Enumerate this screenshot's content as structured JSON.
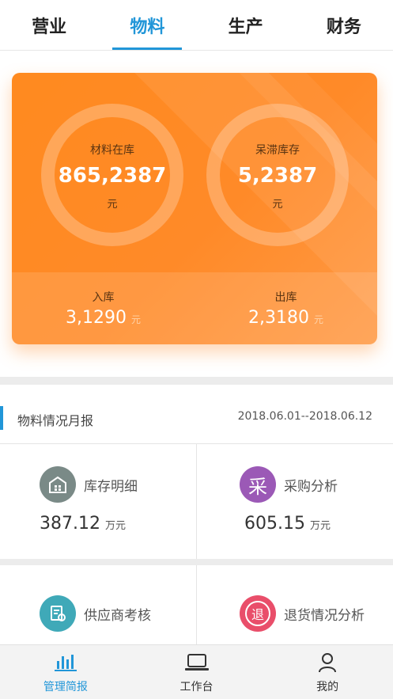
{
  "tabs": [
    {
      "label": "营业"
    },
    {
      "label": "物料"
    },
    {
      "label": "生产"
    },
    {
      "label": "财务"
    }
  ],
  "active_tab": "物料",
  "summary": {
    "left": {
      "label": "材料在库",
      "value": "865,2387",
      "unit": "元"
    },
    "right": {
      "label": "呆滞库存",
      "value": "5,2387",
      "unit": "元"
    },
    "inbound": {
      "label": "入库",
      "value": "3,1290",
      "unit": "元"
    },
    "outbound": {
      "label": "出库",
      "value": "2,3180",
      "unit": "元"
    }
  },
  "report": {
    "title": "物料情况月报",
    "date_range": "2018.06.01--2018.06.12"
  },
  "tiles": [
    {
      "name": "库存明细",
      "value": "387.12",
      "unit": "万元",
      "icon": "warehouse-icon",
      "color": "#7a8a87"
    },
    {
      "name": "采购分析",
      "value": "605.15",
      "unit": "万元",
      "icon": "purchase-icon",
      "icon_char": "采",
      "color": "#9b59b6"
    },
    {
      "name": "供应商考核",
      "icon": "supplier-icon",
      "color": "#3fa9b8"
    },
    {
      "name": "退货情况分析",
      "icon": "return-icon",
      "icon_char": "退",
      "color": "#e94e6a"
    }
  ],
  "bottom_nav": [
    {
      "label": "管理简报",
      "icon": "bar-chart-icon"
    },
    {
      "label": "工作台",
      "icon": "laptop-icon"
    },
    {
      "label": "我的",
      "icon": "user-icon"
    }
  ],
  "colors": {
    "accent": "#2196d8",
    "card": "#ff8a1f"
  }
}
